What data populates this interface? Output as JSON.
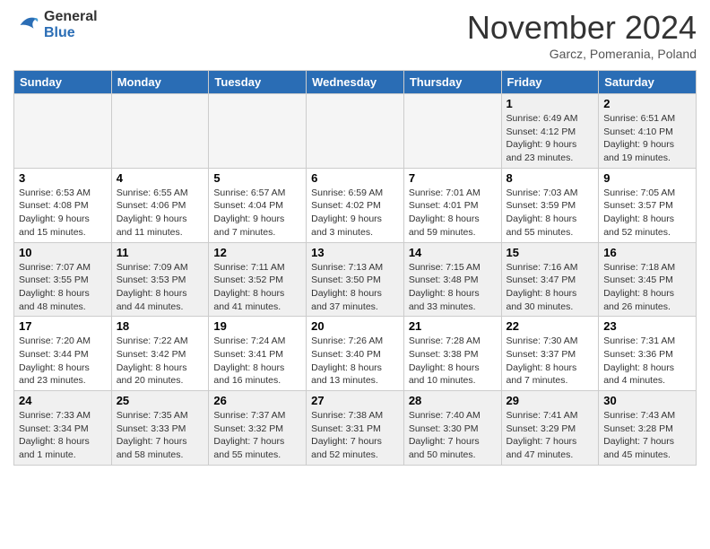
{
  "header": {
    "logo_general": "General",
    "logo_blue": "Blue",
    "title": "November 2024",
    "location": "Garcz, Pomerania, Poland"
  },
  "days_of_week": [
    "Sunday",
    "Monday",
    "Tuesday",
    "Wednesday",
    "Thursday",
    "Friday",
    "Saturday"
  ],
  "weeks": [
    [
      {
        "day": "",
        "details": "",
        "empty": true
      },
      {
        "day": "",
        "details": "",
        "empty": true
      },
      {
        "day": "",
        "details": "",
        "empty": true
      },
      {
        "day": "",
        "details": "",
        "empty": true
      },
      {
        "day": "",
        "details": "",
        "empty": true
      },
      {
        "day": "1",
        "details": "Sunrise: 6:49 AM\nSunset: 4:12 PM\nDaylight: 9 hours\nand 23 minutes."
      },
      {
        "day": "2",
        "details": "Sunrise: 6:51 AM\nSunset: 4:10 PM\nDaylight: 9 hours\nand 19 minutes."
      }
    ],
    [
      {
        "day": "3",
        "details": "Sunrise: 6:53 AM\nSunset: 4:08 PM\nDaylight: 9 hours\nand 15 minutes."
      },
      {
        "day": "4",
        "details": "Sunrise: 6:55 AM\nSunset: 4:06 PM\nDaylight: 9 hours\nand 11 minutes."
      },
      {
        "day": "5",
        "details": "Sunrise: 6:57 AM\nSunset: 4:04 PM\nDaylight: 9 hours\nand 7 minutes."
      },
      {
        "day": "6",
        "details": "Sunrise: 6:59 AM\nSunset: 4:02 PM\nDaylight: 9 hours\nand 3 minutes."
      },
      {
        "day": "7",
        "details": "Sunrise: 7:01 AM\nSunset: 4:01 PM\nDaylight: 8 hours\nand 59 minutes."
      },
      {
        "day": "8",
        "details": "Sunrise: 7:03 AM\nSunset: 3:59 PM\nDaylight: 8 hours\nand 55 minutes."
      },
      {
        "day": "9",
        "details": "Sunrise: 7:05 AM\nSunset: 3:57 PM\nDaylight: 8 hours\nand 52 minutes."
      }
    ],
    [
      {
        "day": "10",
        "details": "Sunrise: 7:07 AM\nSunset: 3:55 PM\nDaylight: 8 hours\nand 48 minutes."
      },
      {
        "day": "11",
        "details": "Sunrise: 7:09 AM\nSunset: 3:53 PM\nDaylight: 8 hours\nand 44 minutes."
      },
      {
        "day": "12",
        "details": "Sunrise: 7:11 AM\nSunset: 3:52 PM\nDaylight: 8 hours\nand 41 minutes."
      },
      {
        "day": "13",
        "details": "Sunrise: 7:13 AM\nSunset: 3:50 PM\nDaylight: 8 hours\nand 37 minutes."
      },
      {
        "day": "14",
        "details": "Sunrise: 7:15 AM\nSunset: 3:48 PM\nDaylight: 8 hours\nand 33 minutes."
      },
      {
        "day": "15",
        "details": "Sunrise: 7:16 AM\nSunset: 3:47 PM\nDaylight: 8 hours\nand 30 minutes."
      },
      {
        "day": "16",
        "details": "Sunrise: 7:18 AM\nSunset: 3:45 PM\nDaylight: 8 hours\nand 26 minutes."
      }
    ],
    [
      {
        "day": "17",
        "details": "Sunrise: 7:20 AM\nSunset: 3:44 PM\nDaylight: 8 hours\nand 23 minutes."
      },
      {
        "day": "18",
        "details": "Sunrise: 7:22 AM\nSunset: 3:42 PM\nDaylight: 8 hours\nand 20 minutes."
      },
      {
        "day": "19",
        "details": "Sunrise: 7:24 AM\nSunset: 3:41 PM\nDaylight: 8 hours\nand 16 minutes."
      },
      {
        "day": "20",
        "details": "Sunrise: 7:26 AM\nSunset: 3:40 PM\nDaylight: 8 hours\nand 13 minutes."
      },
      {
        "day": "21",
        "details": "Sunrise: 7:28 AM\nSunset: 3:38 PM\nDaylight: 8 hours\nand 10 minutes."
      },
      {
        "day": "22",
        "details": "Sunrise: 7:30 AM\nSunset: 3:37 PM\nDaylight: 8 hours\nand 7 minutes."
      },
      {
        "day": "23",
        "details": "Sunrise: 7:31 AM\nSunset: 3:36 PM\nDaylight: 8 hours\nand 4 minutes."
      }
    ],
    [
      {
        "day": "24",
        "details": "Sunrise: 7:33 AM\nSunset: 3:34 PM\nDaylight: 8 hours\nand 1 minute."
      },
      {
        "day": "25",
        "details": "Sunrise: 7:35 AM\nSunset: 3:33 PM\nDaylight: 7 hours\nand 58 minutes."
      },
      {
        "day": "26",
        "details": "Sunrise: 7:37 AM\nSunset: 3:32 PM\nDaylight: 7 hours\nand 55 minutes."
      },
      {
        "day": "27",
        "details": "Sunrise: 7:38 AM\nSunset: 3:31 PM\nDaylight: 7 hours\nand 52 minutes."
      },
      {
        "day": "28",
        "details": "Sunrise: 7:40 AM\nSunset: 3:30 PM\nDaylight: 7 hours\nand 50 minutes."
      },
      {
        "day": "29",
        "details": "Sunrise: 7:41 AM\nSunset: 3:29 PM\nDaylight: 7 hours\nand 47 minutes."
      },
      {
        "day": "30",
        "details": "Sunrise: 7:43 AM\nSunset: 3:28 PM\nDaylight: 7 hours\nand 45 minutes."
      }
    ]
  ]
}
